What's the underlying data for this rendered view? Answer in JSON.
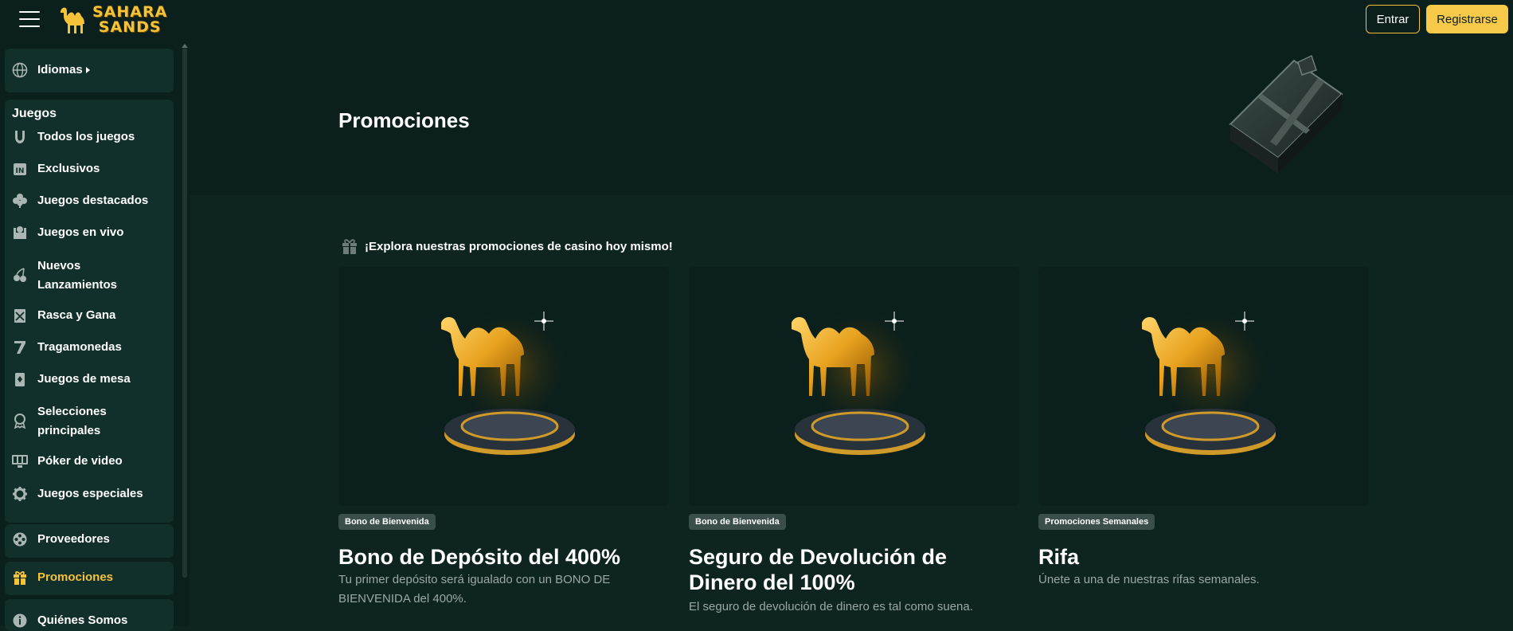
{
  "header": {
    "logo_line1": "SAHARA",
    "logo_line2": "SANDS",
    "login_label": "Entrar",
    "register_label": "Registrarse",
    "accent": "#f7c948"
  },
  "sidebar": {
    "language_label": "Idiomas",
    "section_title": "Juegos",
    "items": [
      {
        "label": "Todos los juegos",
        "icon": "horseshoe-icon"
      },
      {
        "label": "Exclusivos",
        "icon": "exclusive-icon"
      },
      {
        "label": "Juegos destacados",
        "icon": "clover-icon"
      },
      {
        "label": "Juegos en vivo",
        "icon": "live-dealer-icon"
      },
      {
        "label": "Nuevos Lanzamientos",
        "icon": "cherries-icon"
      },
      {
        "label": "Rasca y Gana",
        "icon": "scratch-card-icon"
      },
      {
        "label": "Tragamonedas",
        "icon": "seven-icon"
      },
      {
        "label": "Juegos de mesa",
        "icon": "cards-icon"
      },
      {
        "label": "Selecciones principales",
        "icon": "award-icon"
      },
      {
        "label": "Póker de video",
        "icon": "video-poker-icon"
      },
      {
        "label": "Juegos especiales",
        "icon": "gear-icon"
      }
    ],
    "providers_label": "Proveedores",
    "promotions_label": "Promociones",
    "about_label": "Quiénes Somos"
  },
  "hero": {
    "title": "Promociones"
  },
  "intro": {
    "text": "¡Explora nuestras promociones de casino hoy mismo!"
  },
  "cards": [
    {
      "badge": "Bono de Bienvenida",
      "title": "Bono de Depósito del 400%",
      "description": "Tu primer depósito será igualado con un BONO DE BIENVENIDA del 400%."
    },
    {
      "badge": "Bono de Bienvenida",
      "title": "Seguro de Devolución de Dinero del 100%",
      "description": "El seguro de devolución de dinero es tal como suena."
    },
    {
      "badge": "Promociones Semanales",
      "title": "Rifa",
      "description": "Únete a una de nuestras rifas semanales."
    }
  ]
}
